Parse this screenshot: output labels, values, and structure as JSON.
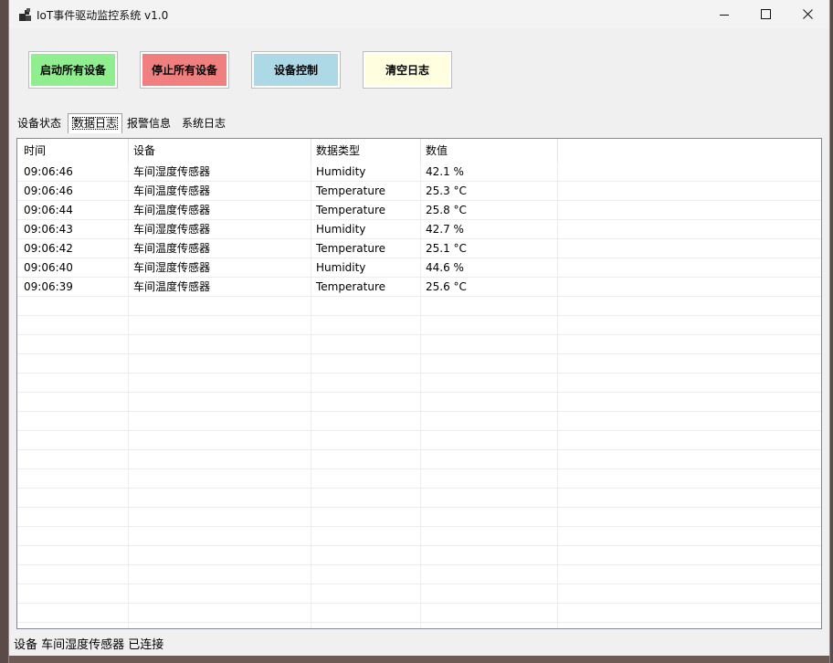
{
  "window": {
    "title": "IoT事件驱动监控系统 v1.0",
    "icon": "app-icon"
  },
  "toolbar": {
    "start_label": "启动所有设备",
    "stop_label": "停止所有设备",
    "control_label": "设备控制",
    "clear_label": "清空日志",
    "colors": {
      "start": "#90ee90",
      "stop": "#f08080",
      "control": "#add8e6",
      "clear": "#ffffe0"
    }
  },
  "tabs": [
    "设备状态",
    "数据日志",
    "报警信息",
    "系统日志"
  ],
  "active_tab": "数据日志",
  "table": {
    "columns": [
      "时间",
      "设备",
      "数据类型",
      "数值"
    ],
    "rows": [
      [
        "09:06:46",
        "车间湿度传感器",
        "Humidity",
        "42.1 %"
      ],
      [
        "09:06:46",
        "车间温度传感器",
        "Temperature",
        "25.3 °C"
      ],
      [
        "09:06:44",
        "车间温度传感器",
        "Temperature",
        "25.8 °C"
      ],
      [
        "09:06:43",
        "车间湿度传感器",
        "Humidity",
        "42.7 %"
      ],
      [
        "09:06:42",
        "车间温度传感器",
        "Temperature",
        "25.1 °C"
      ],
      [
        "09:06:40",
        "车间湿度传感器",
        "Humidity",
        "44.6 %"
      ],
      [
        "09:06:39",
        "车间温度传感器",
        "Temperature",
        "25.6 °C"
      ]
    ]
  },
  "status": {
    "text": "设备 车间湿度传感器 已连接"
  }
}
